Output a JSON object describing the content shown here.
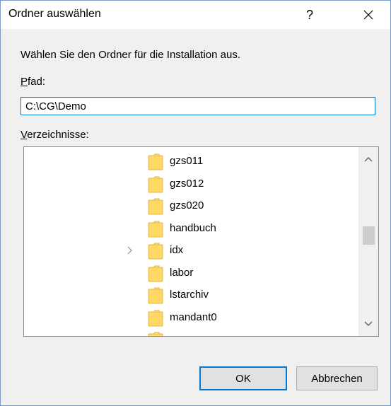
{
  "window": {
    "title": "Ordner auswählen",
    "help_label": "?"
  },
  "prompt": "Wählen Sie den Ordner für die Installation aus.",
  "path": {
    "label_accel": "P",
    "label_rest": "fad:",
    "value": "C:\\CG\\Demo"
  },
  "directories": {
    "label_accel": "V",
    "label_rest": "erzeichnisse:",
    "items": [
      {
        "label": "gzs011",
        "has_children": false
      },
      {
        "label": "gzs012",
        "has_children": false
      },
      {
        "label": "gzs020",
        "has_children": false
      },
      {
        "label": "handbuch",
        "has_children": false
      },
      {
        "label": "idx",
        "has_children": true
      },
      {
        "label": "labor",
        "has_children": false
      },
      {
        "label": "lstarchiv",
        "has_children": false
      },
      {
        "label": "mandant0",
        "has_children": false
      },
      {
        "label": "",
        "has_children": false
      }
    ],
    "scroll_position": 0.45
  },
  "buttons": {
    "ok": "OK",
    "cancel": "Abbrechen"
  },
  "colors": {
    "accent": "#0078d7",
    "folder": "#ffd866",
    "folder_edge": "#e0b84a",
    "dialog_bg": "#f0f0f0"
  },
  "icons": {
    "close": "close-icon",
    "folder": "folder-icon",
    "expander": "chevron-right-icon",
    "scroll_up": "chevron-up-icon",
    "scroll_down": "chevron-down-icon"
  }
}
